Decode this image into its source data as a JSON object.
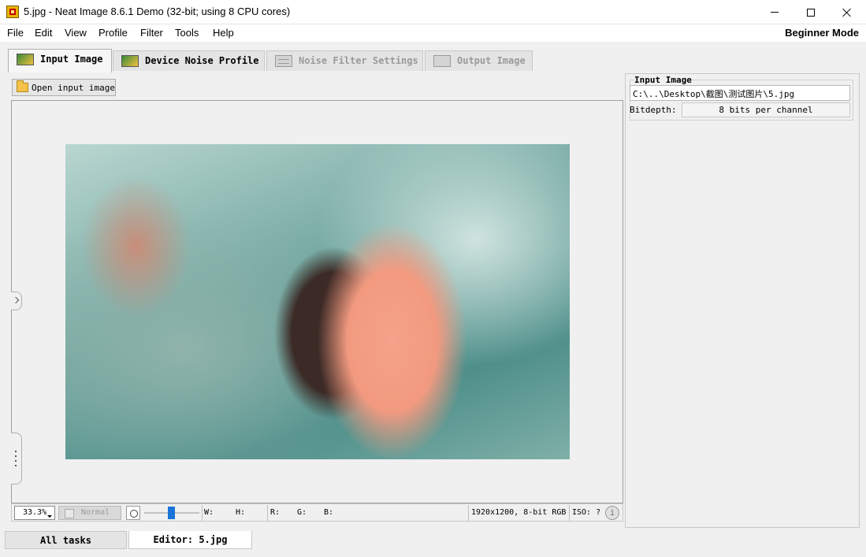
{
  "window": {
    "title": "5.jpg - Neat Image 8.6.1 Demo (32-bit; using 8 CPU cores)"
  },
  "menu": {
    "items": [
      "File",
      "Edit",
      "View",
      "Profile",
      "Filter",
      "Tools",
      "Help"
    ],
    "mode": "Beginner Mode"
  },
  "tabs": [
    {
      "label": "Input Image",
      "state": "active"
    },
    {
      "label": "Device Noise Profile",
      "state": "enabled"
    },
    {
      "label": "Noise Filter Settings",
      "state": "disabled"
    },
    {
      "label": "Output Image",
      "state": "disabled"
    }
  ],
  "editor": {
    "open_button": "Open input image"
  },
  "status": {
    "zoom": "33.3%",
    "view_mode": "Normal",
    "w_label": "W:",
    "h_label": "H:",
    "r_label": "R:",
    "g_label": "G:",
    "b_label": "B:",
    "image_info": "1920x1200, 8-bit RGB",
    "iso": "ISO: ?"
  },
  "input_panel": {
    "title": "Input Image",
    "path": "C:\\..\\Desktop\\截图\\测试图片\\5.jpg",
    "bitdepth_label": "Bitdepth:",
    "bitdepth_value": "8 bits per channel"
  },
  "tasks": {
    "all": "All tasks",
    "editor": "Editor: 5.jpg"
  },
  "colors": {
    "slider_accent": "#1a73d9",
    "background": "#f0f0f0"
  },
  "icons": [
    "app-icon",
    "minimize-icon",
    "maximize-icon",
    "close-icon",
    "folder-icon",
    "brightness-icon",
    "info-icon"
  ]
}
